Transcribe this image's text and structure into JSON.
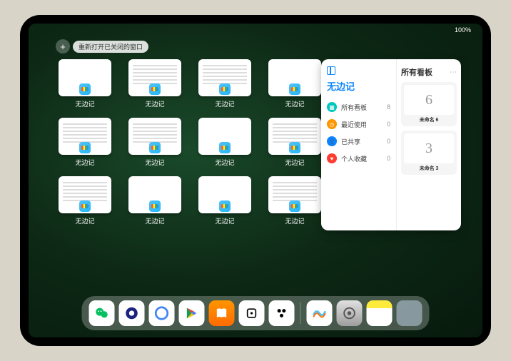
{
  "status": {
    "left": "",
    "right": "100%"
  },
  "toolbar": {
    "add": "+",
    "reopen": "重新打开已关闭的窗口"
  },
  "app_name": "无边记",
  "windows": [
    {
      "variant": "blank"
    },
    {
      "variant": "detailed"
    },
    {
      "variant": "detailed"
    },
    {
      "variant": "blank"
    },
    {
      "variant": "detailed"
    },
    {
      "variant": "detailed"
    },
    {
      "variant": "blank"
    },
    {
      "variant": "detailed"
    },
    {
      "variant": "detailed"
    },
    {
      "variant": "blank"
    },
    {
      "variant": "blank"
    },
    {
      "variant": "detailed"
    }
  ],
  "panel": {
    "title": "无边记",
    "items": [
      {
        "icon": "grid",
        "color": "#00c7be",
        "label": "所有看板",
        "count": 8
      },
      {
        "icon": "clock",
        "color": "#ff9500",
        "label": "最近使用",
        "count": 0
      },
      {
        "icon": "person",
        "color": "#0a84ff",
        "label": "已共享",
        "count": 0
      },
      {
        "icon": "heart",
        "color": "#ff3b30",
        "label": "个人收藏",
        "count": 0
      }
    ],
    "right_title": "所有看板",
    "boards": [
      {
        "glyph": "6",
        "name": "未命名 6",
        "sub": ""
      },
      {
        "glyph": "3",
        "name": "未命名 3",
        "sub": ""
      }
    ]
  },
  "dock": [
    {
      "name": "wechat",
      "cls": "d-wechat"
    },
    {
      "name": "browser",
      "cls": "d-eye"
    },
    {
      "name": "quark",
      "cls": "d-q"
    },
    {
      "name": "play",
      "cls": "d-play"
    },
    {
      "name": "books",
      "cls": "d-books"
    },
    {
      "name": "dice",
      "cls": "d-dice"
    },
    {
      "name": "app",
      "cls": "d-radio"
    },
    {
      "name": "sep"
    },
    {
      "name": "freeform",
      "cls": "d-freeform"
    },
    {
      "name": "settings",
      "cls": "d-settings"
    },
    {
      "name": "notes",
      "cls": "d-notes"
    },
    {
      "name": "recent",
      "cls": "d-multi"
    }
  ]
}
